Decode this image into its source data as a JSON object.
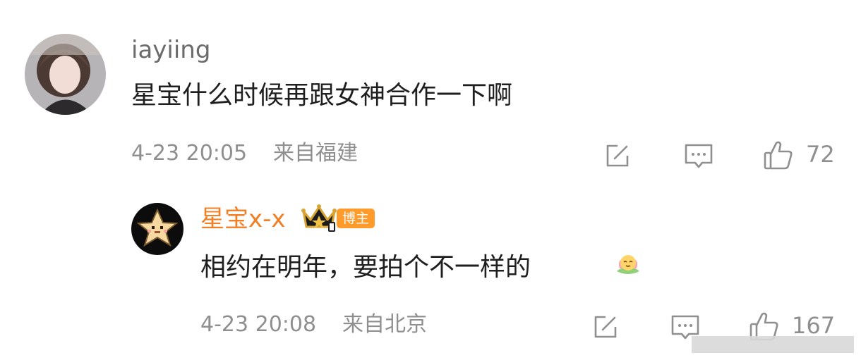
{
  "comment": {
    "username": "iayiing",
    "text": "星宝什么时候再跟女神合作一下啊",
    "timestamp": "4-23 20:05",
    "location": "来自福建",
    "likes": "72",
    "icons": {
      "share": "share-icon",
      "reply": "comment-icon",
      "like": "thumbs-up-icon"
    }
  },
  "reply": {
    "username": "星宝x-x",
    "badge": "博主",
    "text": "相约在明年，要拍个不一样的",
    "emoji": "lotus-emoji",
    "timestamp": "4-23 20:08",
    "location": "来自北京",
    "likes": "167",
    "icons": {
      "share": "share-icon",
      "reply": "comment-icon",
      "like": "thumbs-up-icon"
    }
  },
  "colors": {
    "username": "#6b6b6b",
    "reply_username": "#f07f26",
    "badge": "#ff9b2b",
    "meta": "#8f8f8f",
    "text": "#1f1f1f"
  }
}
